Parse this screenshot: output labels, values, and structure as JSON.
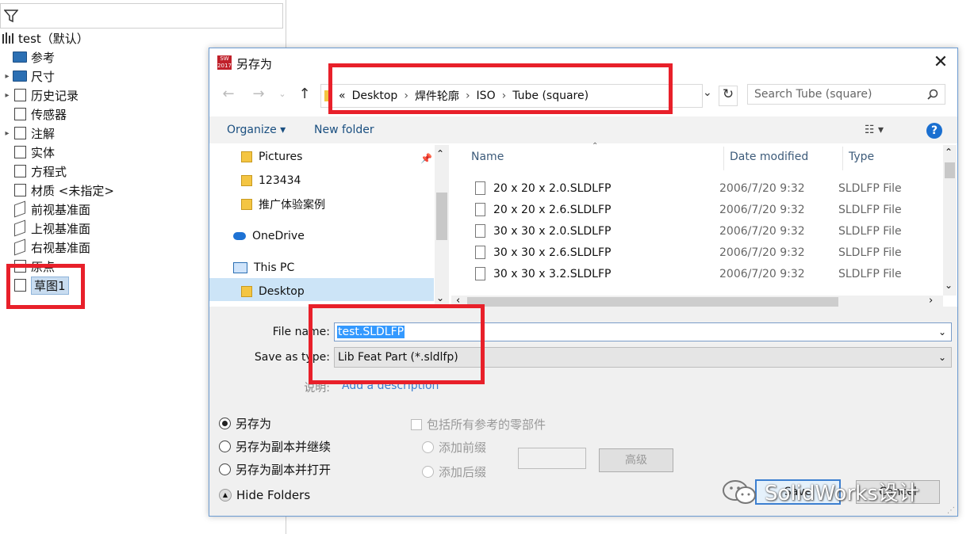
{
  "tree": {
    "root_label": "test（默认）",
    "items": [
      {
        "label": "参考",
        "arrow": "",
        "icon": "folder-icon"
      },
      {
        "label": "尺寸",
        "arrow": "▸",
        "icon": "folder-icon"
      },
      {
        "label": "历史记录",
        "arrow": "▸",
        "icon": "history-icon"
      },
      {
        "label": "传感器",
        "arrow": "",
        "icon": "sensor-icon"
      },
      {
        "label": "注解",
        "arrow": "▸",
        "icon": "annotation-icon"
      },
      {
        "label": "实体",
        "arrow": "",
        "icon": "solid-body-icon"
      },
      {
        "label": "方程式",
        "arrow": "",
        "icon": "equation-icon"
      },
      {
        "label": "材质 <未指定>",
        "arrow": "",
        "icon": "material-icon"
      },
      {
        "label": "前视基准面",
        "arrow": "",
        "icon": "plane-icon"
      },
      {
        "label": "上视基准面",
        "arrow": "",
        "icon": "plane-icon"
      },
      {
        "label": "右视基准面",
        "arrow": "",
        "icon": "plane-icon"
      },
      {
        "label": "原点",
        "arrow": "",
        "icon": "origin-icon"
      },
      {
        "label": "草图1",
        "arrow": "",
        "icon": "sketch-icon"
      }
    ]
  },
  "dialog": {
    "title": "另存为",
    "close": "✕",
    "breadcrumb": {
      "overflow": "«",
      "parts": [
        "Desktop",
        "焊件轮廓",
        "ISO",
        "Tube (square)"
      ]
    },
    "search_placeholder": "Search Tube (square)",
    "toolbar": {
      "organize": "Organize ▾",
      "new_folder": "New folder",
      "help": "?"
    },
    "nav_items": [
      {
        "label": "Pictures",
        "icon": "folder-icon"
      },
      {
        "label": "123434",
        "icon": "folder-icon"
      },
      {
        "label": "推广体验案例",
        "icon": "folder-icon"
      },
      {
        "label": "OneDrive",
        "icon": "cloud-icon"
      },
      {
        "label": "This PC",
        "icon": "computer-icon"
      },
      {
        "label": "Desktop",
        "icon": "folder-icon"
      }
    ],
    "columns": {
      "name": "Name",
      "date": "Date modified",
      "type": "Type"
    },
    "files": [
      {
        "name": "20 x 20 x 2.0.SLDLFP",
        "date": "2006/7/20 9:32",
        "type": "SLDLFP File"
      },
      {
        "name": "20 x 20 x 2.6.SLDLFP",
        "date": "2006/7/20 9:32",
        "type": "SLDLFP File"
      },
      {
        "name": "30 x 30 x 2.0.SLDLFP",
        "date": "2006/7/20 9:32",
        "type": "SLDLFP File"
      },
      {
        "name": "30 x 30 x 2.6.SLDLFP",
        "date": "2006/7/20 9:32",
        "type": "SLDLFP File"
      },
      {
        "name": "30 x 30 x 3.2.SLDLFP",
        "date": "2006/7/20 9:32",
        "type": "SLDLFP File"
      }
    ],
    "file_name_label": "File name:",
    "file_name_value": "test.SLDLFP",
    "save_type_label": "Save as type:",
    "save_type_value": "Lib Feat Part (*.sldlfp)",
    "desc_label": "说明:",
    "desc_link": "Add a description",
    "options": {
      "save_as": "另存为",
      "save_copy_continue": "另存为副本并继续",
      "save_copy_open": "另存为副本并打开",
      "include_refs": "包括所有参考的零部件",
      "add_prefix": "添加前缀",
      "add_suffix": "添加后缀",
      "advanced": "高级"
    },
    "hide_folders": "Hide Folders",
    "save_button": "Save",
    "cancel_button": "Cancel"
  },
  "watermark": "SolidWorks设计",
  "colors": {
    "highlight": "#e8202a",
    "selection": "#3399ff",
    "help": "#1a6fd0"
  }
}
